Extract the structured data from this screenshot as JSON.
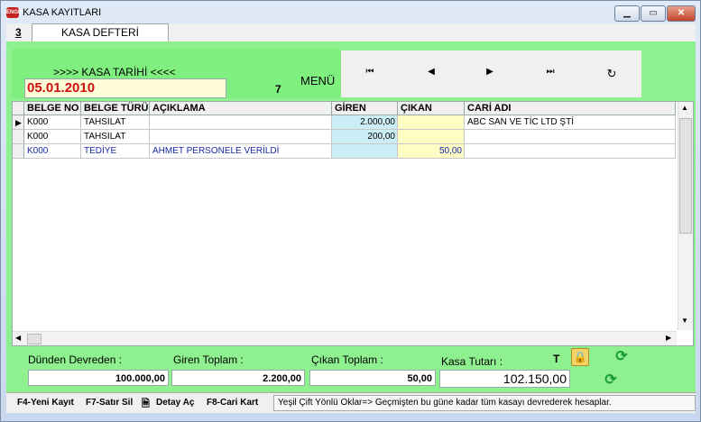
{
  "window": {
    "title": "KASA KAYITLARI",
    "icon": "ENGIN",
    "buttons": [
      "minimize-icon",
      "maximize-icon",
      "close-icon"
    ]
  },
  "tab": {
    "number": "3",
    "label": "KASA DEFTERİ"
  },
  "header": {
    "date_label": ">>>>  KASA TARİHİ  <<<<",
    "date_value": "05.01.2010",
    "count": "7",
    "menu_label": "MENÜ"
  },
  "nav": {
    "first": "⏮",
    "prev": "◀",
    "next": "▶",
    "last": "⏭",
    "refresh": "↻"
  },
  "grid": {
    "columns": [
      "BELGE NO",
      "BELGE TÜRÜ",
      "AÇIKLAMA",
      "GİREN",
      "ÇIKAN",
      "CARİ ADI"
    ],
    "rows": [
      {
        "belge_no": "K000",
        "belge_turu": "TAHSILAT",
        "aciklama": "",
        "giren": "2.000,00",
        "cikan": "",
        "cari_adi": "ABC SAN VE TİC LTD ŞTİ"
      },
      {
        "belge_no": "K000",
        "belge_turu": "TAHSILAT",
        "aciklama": "",
        "giren": "200,00",
        "cikan": "",
        "cari_adi": ""
      },
      {
        "belge_no": "K000",
        "belge_turu": "TEDİYE",
        "aciklama": "AHMET PERSONELE VERİLDİ",
        "giren": "",
        "cikan": "50,00",
        "cari_adi": ""
      }
    ]
  },
  "totals": {
    "devreden_label": "Dünden Devreden :",
    "devreden_value": "100.000,00",
    "giren_label": "Giren Toplam :",
    "giren_value": "2.200,00",
    "cikan_label": "Çıkan Toplam :",
    "cikan_value": "50,00",
    "kasa_label": "Kasa Tutarı :",
    "kasa_value": "102.150,00",
    "t_label": "T"
  },
  "statusbar": {
    "f4": "F4-Yeni Kayıt",
    "f7": "F7-Satır Sil",
    "detay": "Detay Aç",
    "f8": "F8-Cari Kart",
    "message": "Yeşil Çift Yönlü Oklar=> Geçmişten bu güne kadar tüm kasayı devrederek hesaplar."
  },
  "colors": {
    "panel": "#8ef08e",
    "date_red": "#d01010",
    "giren_cell": "#cceff7",
    "cikan_cell": "#fefdc4",
    "row_blue": "#1a2aa8"
  }
}
